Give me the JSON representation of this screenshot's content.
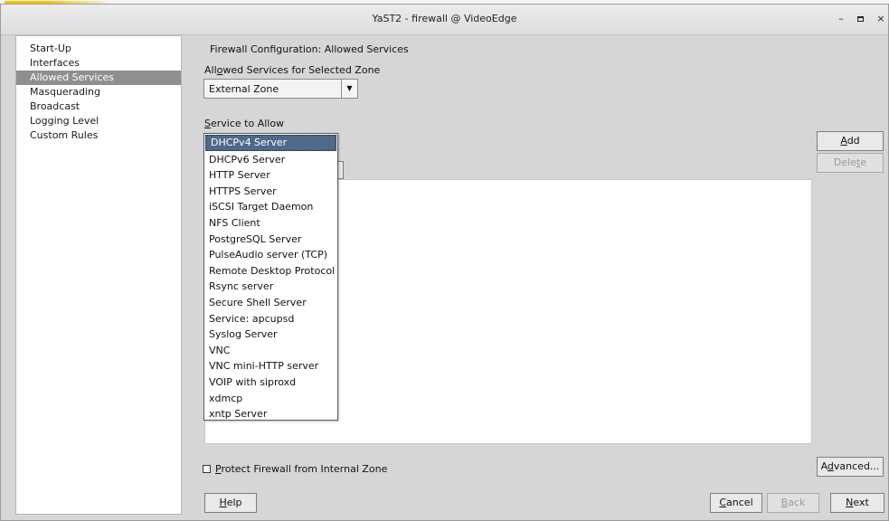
{
  "window": {
    "title": "YaST2 - firewall @ VideoEdge",
    "controls": {
      "minimize": "–",
      "close": "×"
    }
  },
  "sidebar": {
    "items": [
      {
        "label": "Start-Up"
      },
      {
        "label": "Interfaces"
      },
      {
        "label": "Allowed Services",
        "selected": true
      },
      {
        "label": "Masquerading"
      },
      {
        "label": "Broadcast"
      },
      {
        "label": "Logging Level"
      },
      {
        "label": "Custom Rules"
      }
    ]
  },
  "main": {
    "heading": "Firewall Configuration: Allowed Services",
    "zone_label_pre": "All",
    "zone_label_ul": "o",
    "zone_label_post": "wed Services for Selected Zone",
    "zone_value": "External Zone",
    "service_label_ul": "S",
    "service_label_post": "ervice to Allow",
    "service_options": [
      "DHCPv4 Server",
      "DHCPv6 Server",
      "HTTP Server",
      "HTTPS Server",
      "iSCSI Target Daemon",
      "NFS Client",
      "PostgreSQL Server",
      "PulseAudio server (TCP)",
      "Remote Desktop Protocol",
      "Rsync server",
      "Secure Shell Server",
      "Service: apcupsd",
      "Syslog Server",
      "VNC",
      "VNC mini-HTTP server",
      "VOIP with siproxd",
      "xdmcp",
      "xntp Server"
    ],
    "selected_service": "DHCPv4 Server",
    "checkbox_ul": "P",
    "checkbox_post": "rotect Firewall from Internal Zone",
    "checkbox_checked": false
  },
  "buttons": {
    "add_ul": "A",
    "add_post": "dd",
    "delete_pre": "Dele",
    "delete_ul": "t",
    "delete_post": "e",
    "advanced_pre": "A",
    "advanced_ul": "d",
    "advanced_post": "vanced...",
    "help_ul": "H",
    "help_post": "elp",
    "cancel_ul": "C",
    "cancel_post": "ancel",
    "back_ul": "B",
    "back_post": "ack",
    "next_ul": "N",
    "next_post": "ext"
  }
}
